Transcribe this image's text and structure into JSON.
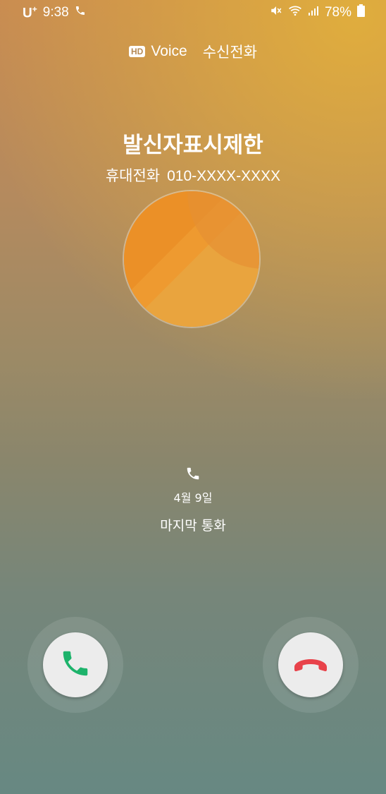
{
  "status_bar": {
    "carrier": "U",
    "carrier_sup": "+",
    "time": "9:38",
    "battery": "78%"
  },
  "header": {
    "hd_badge": "HD",
    "hd_label": "Voice",
    "call_state": "수신전화"
  },
  "caller": {
    "name": "발신자표시제한",
    "number_type": "휴대전화",
    "number": "010-XXXX-XXXX"
  },
  "last_call": {
    "date": "4월 9일",
    "label": "마지막 통화"
  },
  "colors": {
    "accept": "#1db36b",
    "decline": "#e8424a",
    "avatar": "#ee9a30"
  },
  "icons": [
    "mute-icon",
    "wifi-icon",
    "signal-icon",
    "battery-icon",
    "phone-icon",
    "accept-call-icon",
    "decline-call-icon"
  ]
}
